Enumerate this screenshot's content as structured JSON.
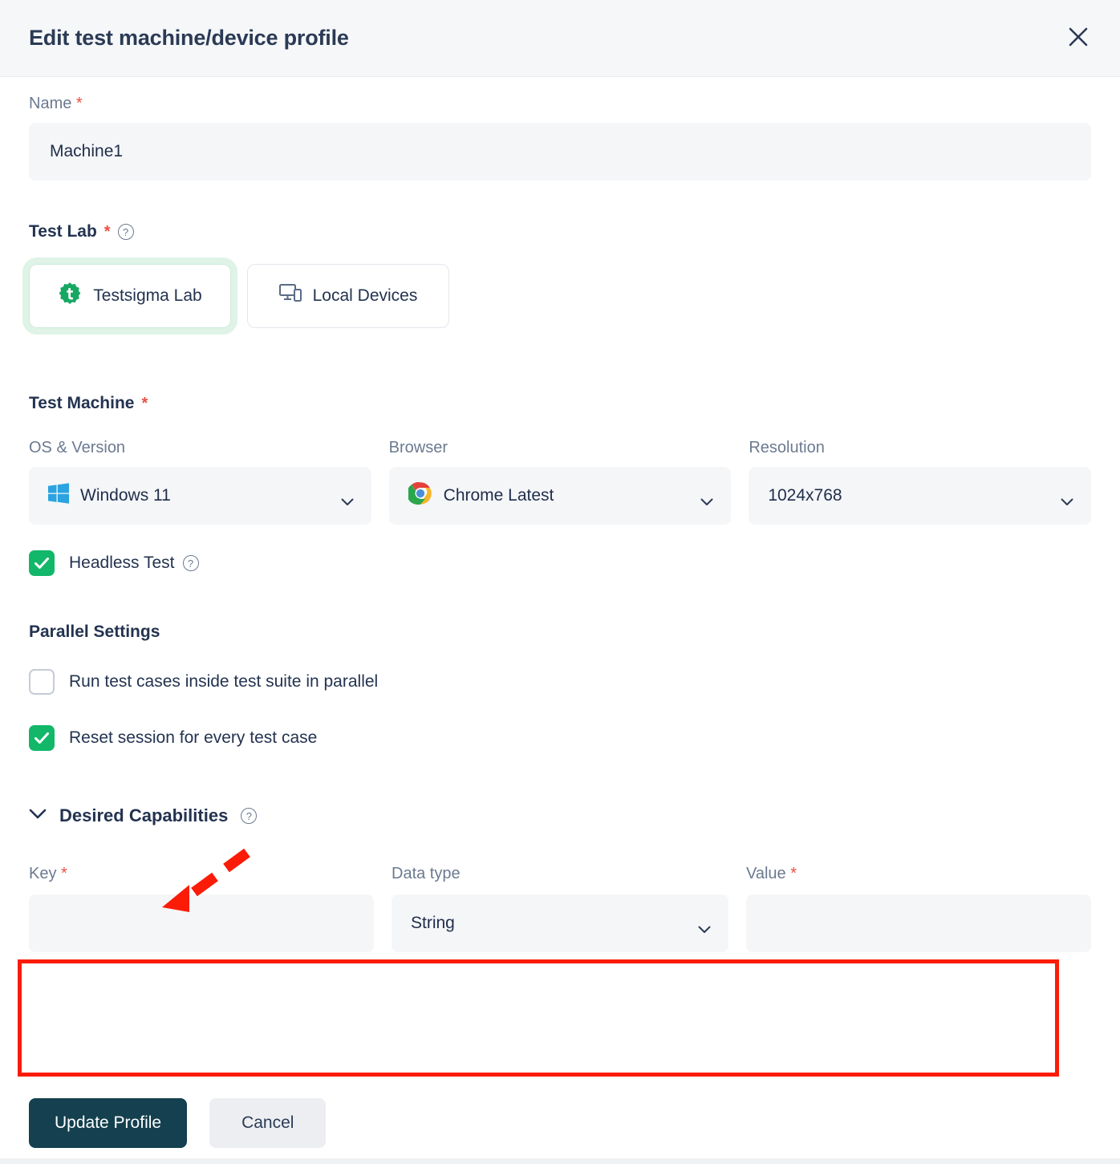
{
  "header": {
    "title": "Edit test machine/device profile",
    "close_icon": "close-icon"
  },
  "name_field": {
    "label": "Name",
    "required_marker": "*",
    "value": "Machine1"
  },
  "test_lab": {
    "label": "Test Lab",
    "required_marker": "*",
    "help_icon": "help-circle-icon",
    "options": [
      {
        "label": "Testsigma Lab",
        "icon": "testsigma-logo-icon",
        "selected": true
      },
      {
        "label": "Local Devices",
        "icon": "devices-icon",
        "selected": false
      }
    ]
  },
  "test_machine": {
    "label": "Test Machine",
    "required_marker": "*",
    "fields": [
      {
        "label": "OS & Version",
        "value": "Windows 11",
        "icon": "windows-logo-icon"
      },
      {
        "label": "Browser",
        "value": "Chrome Latest",
        "icon": "chrome-logo-icon"
      },
      {
        "label": "Resolution",
        "value": "1024x768",
        "icon": ""
      }
    ],
    "headless": {
      "label": "Headless Test",
      "checked": true,
      "help_icon": "help-circle-icon"
    }
  },
  "parallel_settings": {
    "title": "Parallel Settings",
    "options": [
      {
        "label": "Run test cases inside test suite in parallel",
        "checked": false
      },
      {
        "label": "Reset session for every test case",
        "checked": true
      }
    ]
  },
  "desired_capabilities": {
    "title": "Desired Capabilities",
    "expanded": true,
    "chevron_icon": "chevron-down-icon",
    "help_icon": "help-circle-icon",
    "columns": [
      {
        "label": "Key",
        "required_marker": "*",
        "value": ""
      },
      {
        "label": "Data type",
        "required_marker": "",
        "value": "String"
      },
      {
        "label": "Value",
        "required_marker": "*",
        "value": ""
      }
    ]
  },
  "footer": {
    "primary_label": "Update Profile",
    "secondary_label": "Cancel"
  },
  "annotations": {
    "arrow_color": "#fb1c08",
    "box_color": "#fb1c08"
  },
  "colors": {
    "accent_green": "#12b76a",
    "primary_dark": "#14404f",
    "required_red": "#ec4f41",
    "annotation_red": "#fb1c08",
    "input_bg": "#f5f6f8",
    "header_bg": "#f5f7f9"
  }
}
